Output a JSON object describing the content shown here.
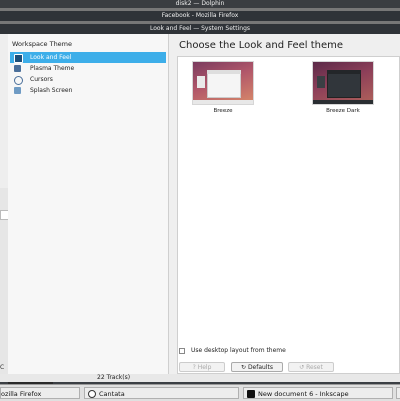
{
  "windows": {
    "dolphin_title": "disk2 — Dolphin",
    "firefox_title": "Facebook - Mozilla Firefox",
    "settings_title": "Look and Feel — System Settings"
  },
  "sidebar": {
    "title": "Workspace Theme",
    "items": [
      {
        "label": "Look and Feel",
        "icon": "look-and-feel-icon",
        "selected": true
      },
      {
        "label": "Plasma Theme",
        "icon": "plasma-theme-icon",
        "selected": false
      },
      {
        "label": "Cursors",
        "icon": "cursors-icon",
        "selected": false
      },
      {
        "label": "Splash Screen",
        "icon": "splash-screen-icon",
        "selected": false
      }
    ]
  },
  "main": {
    "title": "Choose the Look and Feel theme",
    "themes": [
      {
        "name": "Breeze"
      },
      {
        "name": "Breeze Dark"
      }
    ],
    "desktop_layout_label": "Use desktop layout from theme",
    "desktop_layout_checked": false
  },
  "buttons": {
    "help": "Help",
    "defaults": "Defaults",
    "reset": "Reset"
  },
  "left_window": {
    "letter": "C"
  },
  "status": {
    "tracks": "22 Track(s)"
  },
  "taskbar": {
    "items": [
      {
        "label": "ozilla Firefox",
        "icon": "firefox-icon"
      },
      {
        "label": "Cantata",
        "icon": "cantata-icon"
      },
      {
        "label": "New document 6 - Inkscape",
        "icon": "inkscape-icon"
      }
    ]
  },
  "colors": {
    "selection": "#3daee9",
    "titlebar": "#2f3338"
  }
}
